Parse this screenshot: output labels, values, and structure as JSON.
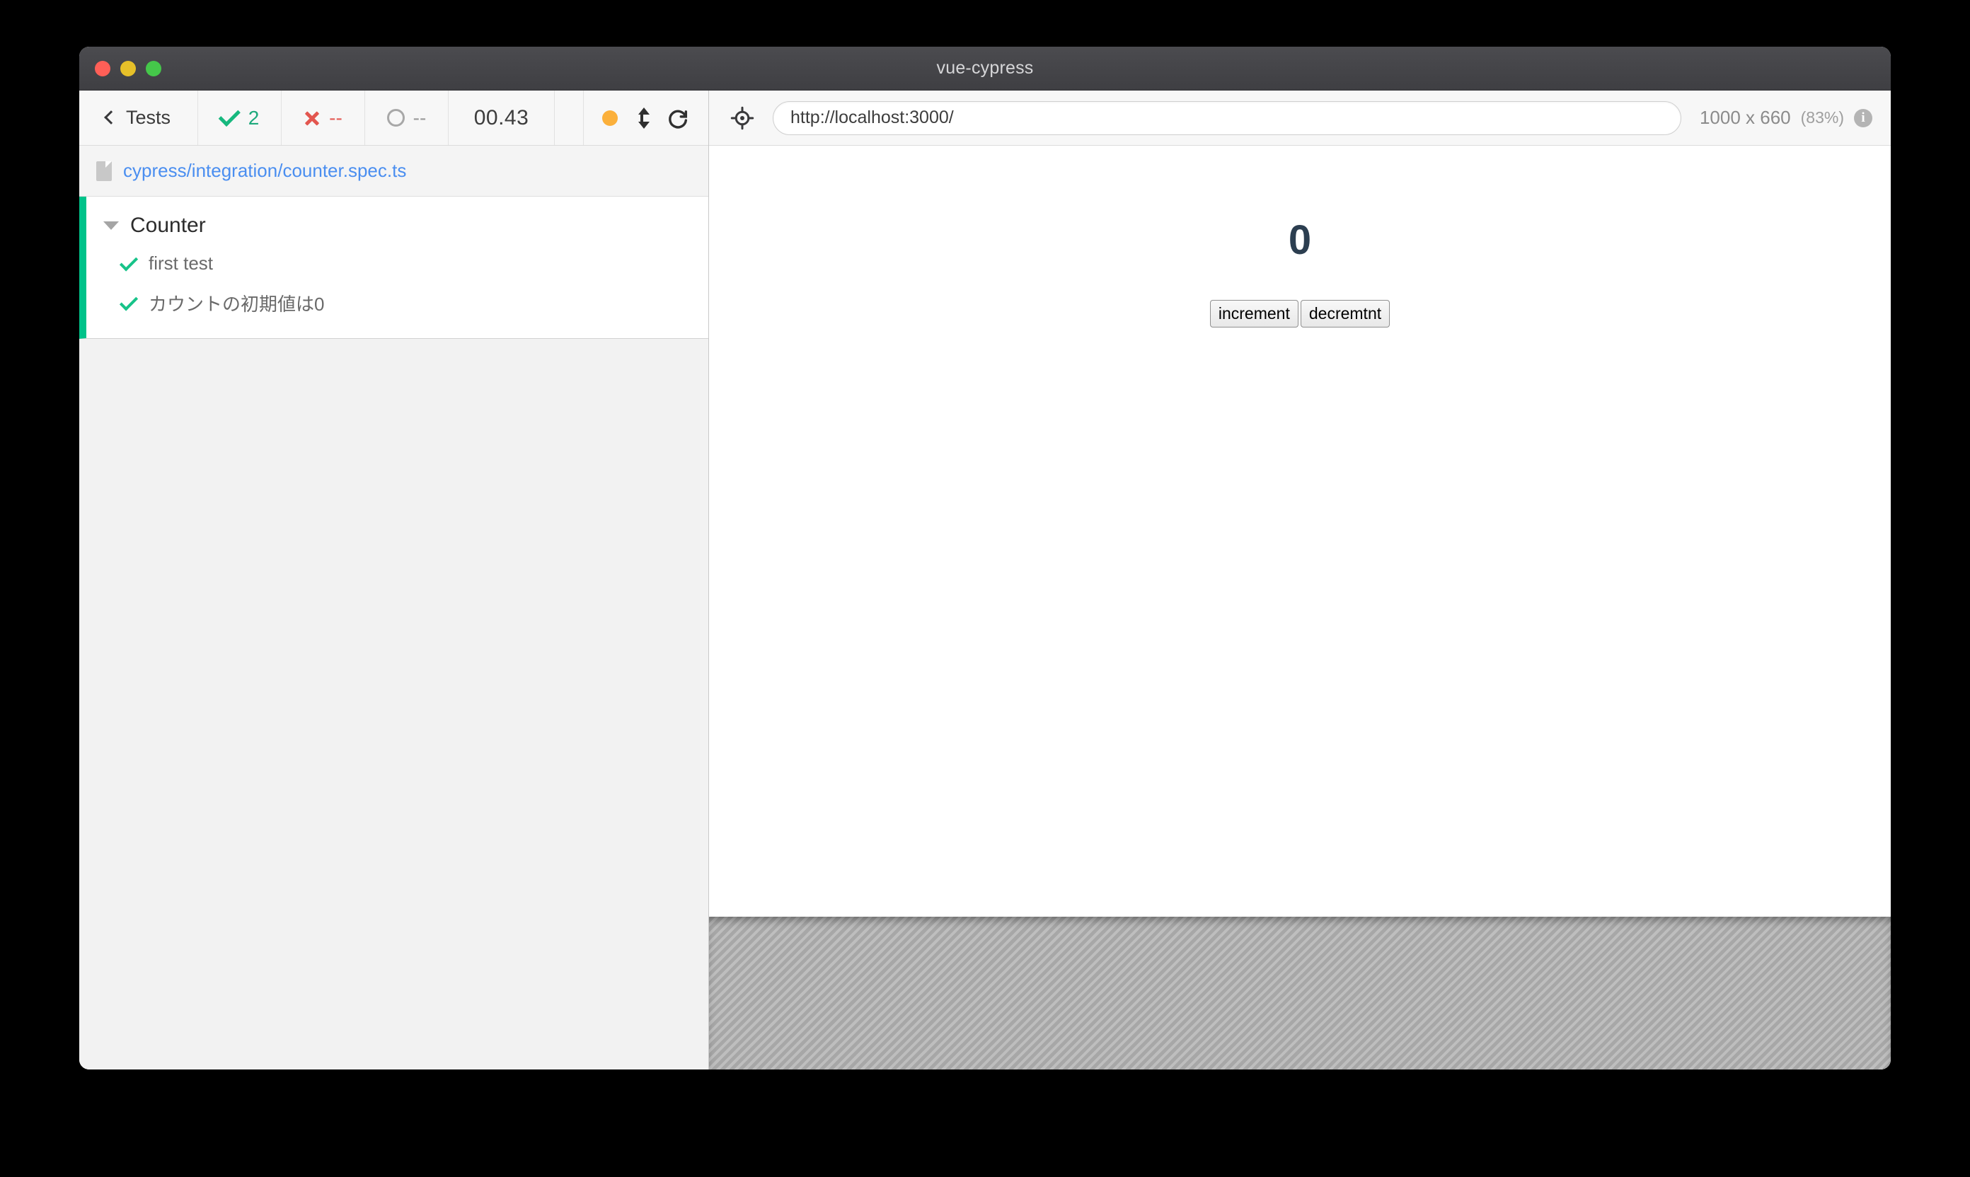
{
  "window": {
    "title": "vue-cypress",
    "traffic_lights": [
      "close-red",
      "minimize-yellow",
      "zoom-green"
    ]
  },
  "toolbar": {
    "back_label": "Tests",
    "stats": {
      "passed": "2",
      "failed": "--",
      "pending": "--"
    },
    "timer": "00.43",
    "icons": {
      "record_dot": "amber-dot-icon",
      "viewport_toggle": "up-down-arrow-icon",
      "reload": "reload-icon"
    }
  },
  "spec": {
    "path": "cypress/integration/counter.spec.ts",
    "file_icon": "file-icon"
  },
  "tests": {
    "suite": "Counter",
    "items": [
      {
        "name": "first test",
        "status": "passed"
      },
      {
        "name": "カウントの初期値は0",
        "status": "passed"
      }
    ],
    "status_color": "#00c38a"
  },
  "preview": {
    "selector_icon": "crosshair-icon",
    "url": "http://localhost:3000/",
    "url_placeholder": "http://localhost:3000/",
    "viewport": "1000 x 660",
    "scale": "(83%)",
    "info_icon_glyph": "i"
  },
  "app": {
    "counter_value": "0",
    "increment_label": "increment",
    "decrement_label": "decremtnt"
  }
}
